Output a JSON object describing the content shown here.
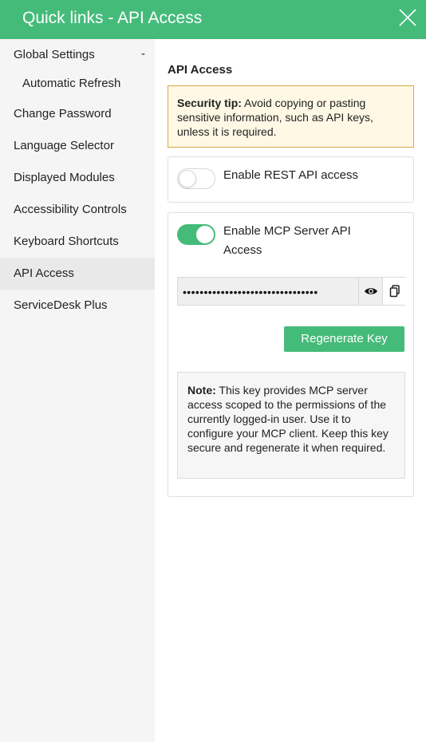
{
  "header": {
    "title": "Quick links - API Access",
    "close_icon": "close-icon"
  },
  "sidebar": {
    "items": [
      {
        "label": "Global Settings",
        "expanded_marker": "-"
      },
      {
        "label": "Automatic Refresh"
      },
      {
        "label": "Change Password"
      },
      {
        "label": "Language Selector"
      },
      {
        "label": "Displayed Modules"
      },
      {
        "label": "Accessibility Controls"
      },
      {
        "label": "Keyboard Shortcuts"
      },
      {
        "label": "API Access",
        "active": true
      },
      {
        "label": "ServiceDesk Plus"
      }
    ]
  },
  "main": {
    "section_title": "API Access",
    "security_tip": {
      "bold": "Security tip:",
      "text": " Avoid copying or pasting sensitive information, such as API keys, unless it is required."
    },
    "rest_toggle": {
      "label": "Enable REST API access",
      "enabled": false
    },
    "mcp_toggle": {
      "label": "Enable MCP Server API Access",
      "enabled": true
    },
    "api_key": {
      "masked_value": "••••••••••••••••••••••••••••••••",
      "show_icon": "eye-icon",
      "copy_icon": "copy-icon"
    },
    "regenerate_label": "Regenerate Key",
    "note": {
      "bold": "Note:",
      "text": " This key provides MCP server access scoped to the permissions of the currently logged-in user. Use it to configure your MCP client. Keep this key secure and regenerate it when required."
    }
  },
  "colors": {
    "accent": "#45bb7a",
    "tip_border": "#d9ab47",
    "tip_bg": "#fff8e5"
  }
}
